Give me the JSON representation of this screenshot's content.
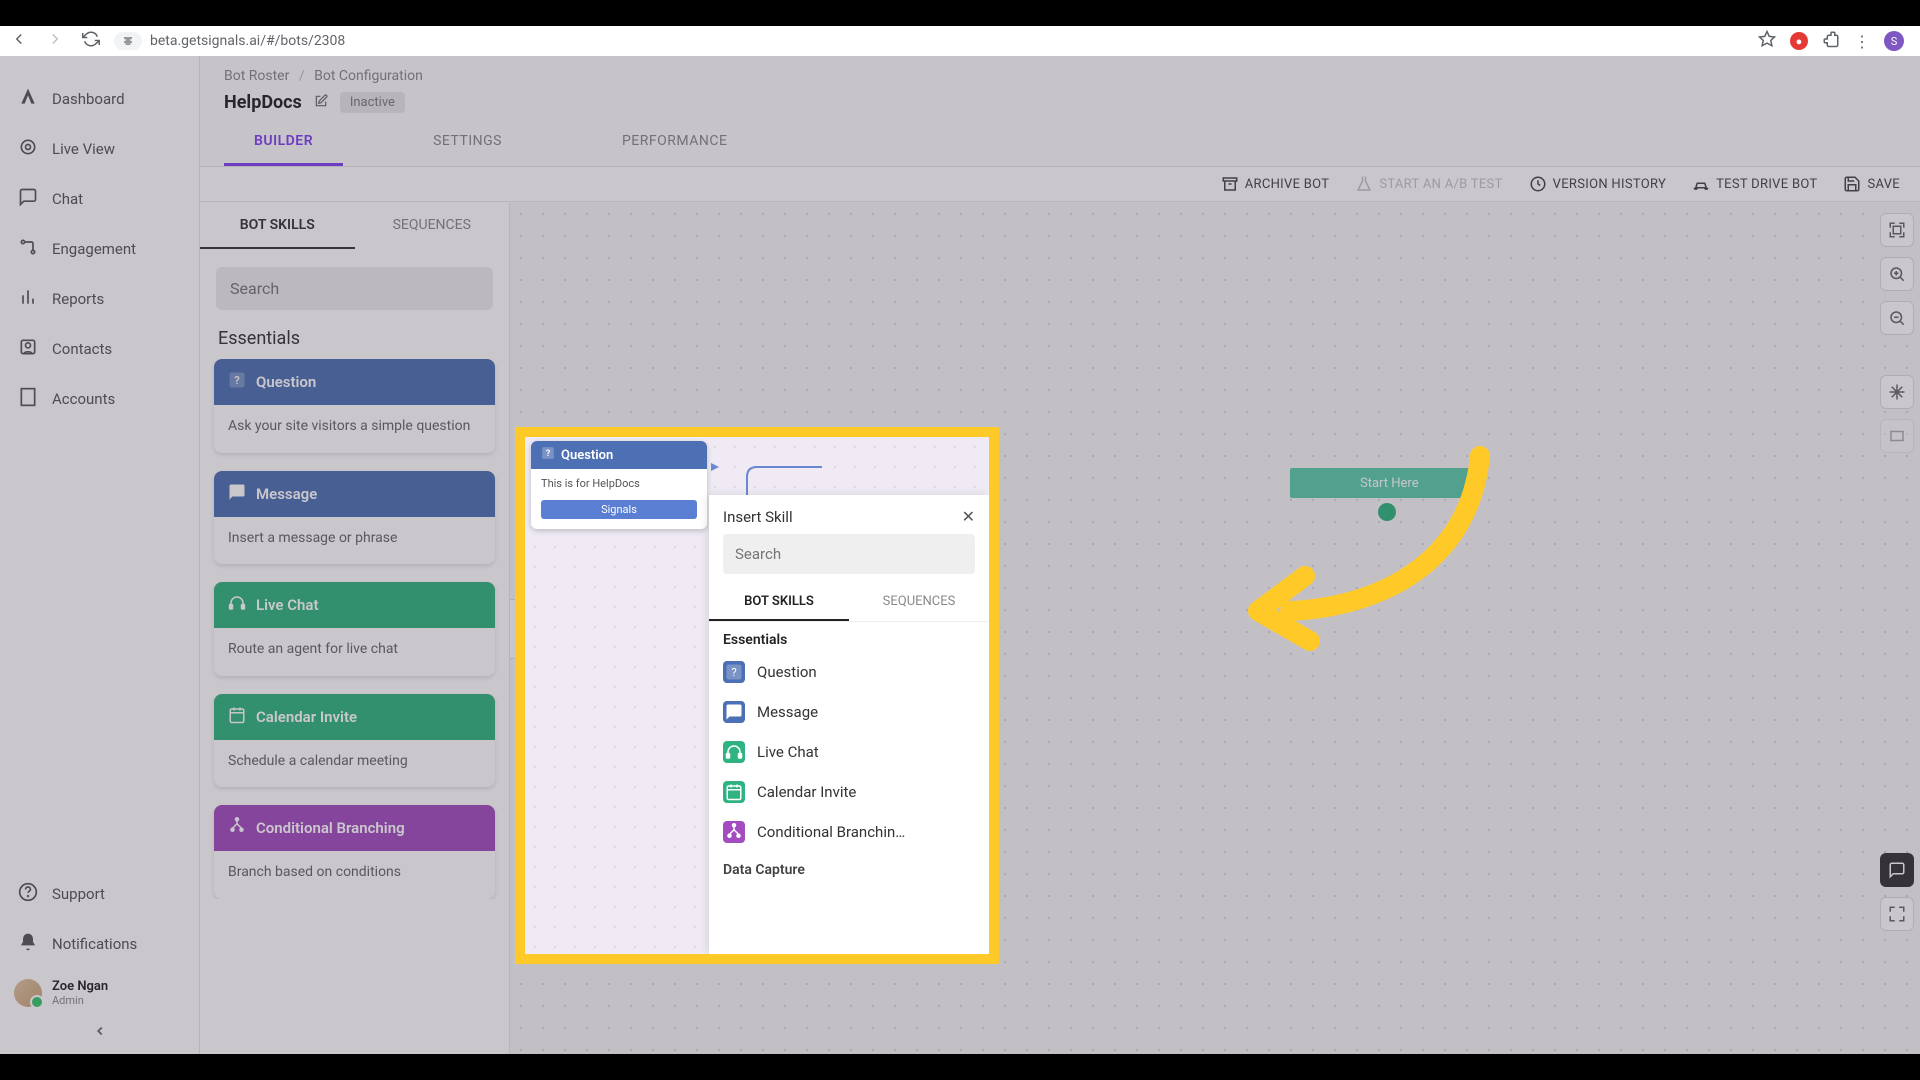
{
  "browser": {
    "url": "beta.getsignals.ai/#/bots/2308",
    "avatar_initial": "S"
  },
  "sidebar": {
    "items": [
      {
        "label": "Dashboard"
      },
      {
        "label": "Live View"
      },
      {
        "label": "Chat"
      },
      {
        "label": "Engagement"
      },
      {
        "label": "Reports"
      },
      {
        "label": "Contacts"
      },
      {
        "label": "Accounts"
      }
    ],
    "support": "Support",
    "notifications": "Notifications",
    "user": {
      "name": "Zoe Ngan",
      "role": "Admin"
    }
  },
  "header": {
    "breadcrumb_root": "Bot Roster",
    "breadcrumb_current": "Bot Configuration",
    "bot_name": "HelpDocs",
    "status_badge": "Inactive",
    "tabs": [
      {
        "label": "BUILDER",
        "active": true
      },
      {
        "label": "SETTINGS"
      },
      {
        "label": "PERFORMANCE"
      }
    ],
    "toolbar": {
      "archive": "ARCHIVE BOT",
      "abtest": "START AN A/B TEST",
      "version": "VERSION HISTORY",
      "testdrive": "TEST DRIVE BOT",
      "save": "SAVE"
    }
  },
  "skill_panel": {
    "tabs": [
      {
        "label": "BOT SKILLS",
        "active": true
      },
      {
        "label": "SEQUENCES"
      }
    ],
    "search_placeholder": "Search",
    "section": "Essentials",
    "cards": [
      {
        "title": "Question",
        "desc": "Ask your site visitors a simple question",
        "color": "sc-blue",
        "icon": "question-icon"
      },
      {
        "title": "Message",
        "desc": "Insert a message or phrase",
        "color": "sc-blue2",
        "icon": "message-icon"
      },
      {
        "title": "Live Chat",
        "desc": "Route an agent for live chat",
        "color": "sc-green",
        "icon": "headset-icon"
      },
      {
        "title": "Calendar Invite",
        "desc": "Schedule a calendar meeting",
        "color": "sc-green2",
        "icon": "calendar-icon"
      },
      {
        "title": "Conditional Branching",
        "desc": "Branch based on conditions",
        "color": "sc-purple",
        "icon": "branch-icon"
      }
    ]
  },
  "canvas": {
    "start_label": "Start Here"
  },
  "highlight": {
    "node_title": "Question",
    "node_body": "This is for HelpDocs",
    "node_button": "Signals"
  },
  "insert_panel": {
    "title": "Insert Skill",
    "search_placeholder": "Search",
    "tabs": [
      {
        "label": "BOT SKILLS",
        "active": true
      },
      {
        "label": "SEQUENCES"
      }
    ],
    "section": "Essentials",
    "items": [
      {
        "label": "Question",
        "color": "#4d6fb3",
        "icon": "question-icon"
      },
      {
        "label": "Message",
        "color": "#4d6fb3",
        "icon": "message-icon"
      },
      {
        "label": "Live Chat",
        "color": "#2fb380",
        "icon": "headset-icon"
      },
      {
        "label": "Calendar Invite",
        "color": "#2fb380",
        "icon": "calendar-icon"
      },
      {
        "label": "Conditional Branchin…",
        "color": "#a24cc0",
        "icon": "branch-icon"
      }
    ],
    "next_section": "Data Capture"
  }
}
